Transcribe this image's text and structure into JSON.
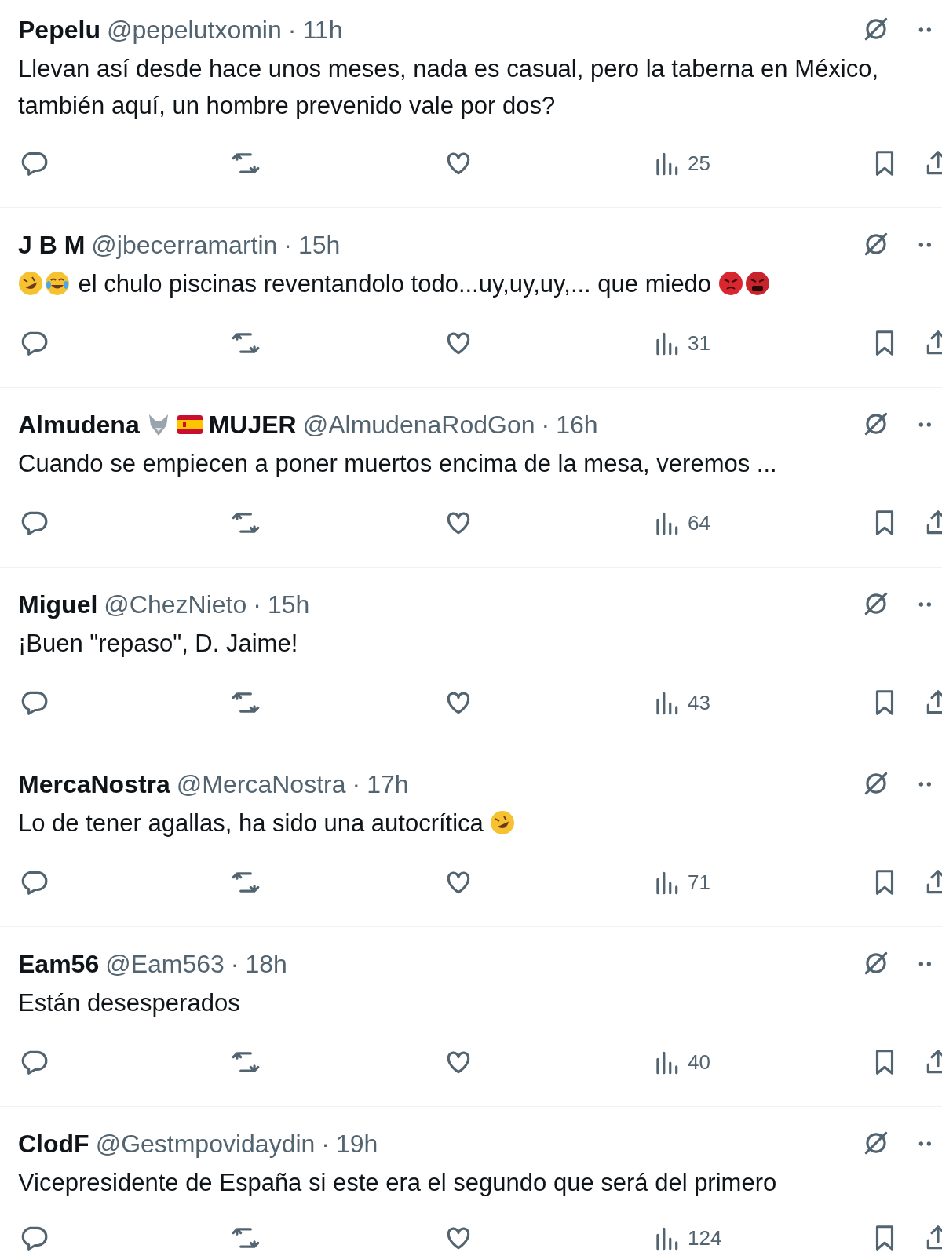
{
  "replies": [
    {
      "name_parts": [
        {
          "kind": "text",
          "text": "Pepelu"
        }
      ],
      "handle": "@pepelutxomin",
      "separator": "·",
      "time": "11h",
      "text_parts": [
        {
          "kind": "text",
          "text": "Llevan así desde hace unos meses, nada es casual, pero la taberna en México, también aquí, un hombre prevenido vale por dos?"
        }
      ],
      "views": "25"
    },
    {
      "name_parts": [
        {
          "kind": "text",
          "text": "J B M"
        }
      ],
      "handle": "@jbecerramartin",
      "separator": "·",
      "time": "15h",
      "text_parts": [
        {
          "kind": "rofl"
        },
        {
          "kind": "joy"
        },
        {
          "kind": "text",
          "text": "el chulo piscinas reventandolo todo...uy,uy,uy,... que miedo"
        },
        {
          "kind": "angry"
        },
        {
          "kind": "cursing"
        }
      ],
      "views": "31"
    },
    {
      "name_parts": [
        {
          "kind": "text",
          "text": "Almudena"
        },
        {
          "kind": "wolf"
        },
        {
          "kind": "flag"
        },
        {
          "kind": "text",
          "text": "MUJER"
        }
      ],
      "handle": "@AlmudenaRodGon",
      "separator": "·",
      "time": "16h",
      "text_parts": [
        {
          "kind": "text",
          "text": "Cuando se empiecen a poner muertos encima de la mesa, veremos ..."
        }
      ],
      "views": "64"
    },
    {
      "name_parts": [
        {
          "kind": "text",
          "text": "Miguel"
        }
      ],
      "handle": "@ChezNieto",
      "separator": "·",
      "time": "15h",
      "text_parts": [
        {
          "kind": "text",
          "text": "¡Buen \"repaso\", D. Jaime!"
        }
      ],
      "views": "43"
    },
    {
      "name_parts": [
        {
          "kind": "text",
          "text": "MercaNostra"
        }
      ],
      "handle": "@MercaNostra",
      "separator": "·",
      "time": "17h",
      "text_parts": [
        {
          "kind": "text",
          "text": "Lo de tener agallas, ha sido una autocrítica"
        },
        {
          "kind": "rofl"
        }
      ],
      "views": "71"
    },
    {
      "name_parts": [
        {
          "kind": "text",
          "text": "Eam56"
        }
      ],
      "handle": "@Eam563",
      "separator": "·",
      "time": "18h",
      "text_parts": [
        {
          "kind": "text",
          "text": "Están desesperados"
        }
      ],
      "views": "40"
    },
    {
      "name_parts": [
        {
          "kind": "text",
          "text": "ClodF"
        }
      ],
      "handle": "@Gestmpovidaydin",
      "separator": "·",
      "time": "19h",
      "text_parts": [
        {
          "kind": "text",
          "text": "Vicepresidente de España si este era el segundo que será del primero"
        }
      ],
      "views": "124"
    }
  ]
}
